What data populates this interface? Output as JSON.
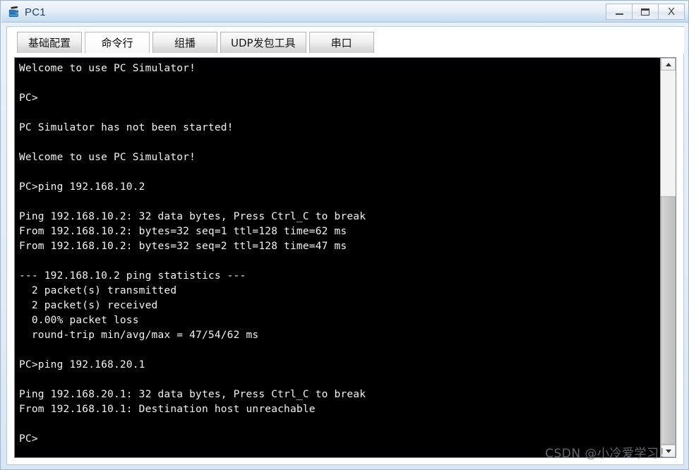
{
  "window": {
    "title": "PC1",
    "icon": "pc-device-icon",
    "controls": {
      "minimize_label": "—",
      "maximize_label": "□",
      "close_label": "X"
    }
  },
  "tabs": [
    {
      "id": "basic-config",
      "label": "基础配置",
      "active": false
    },
    {
      "id": "command-line",
      "label": "命令行",
      "active": true
    },
    {
      "id": "multicast",
      "label": "组播",
      "active": false
    },
    {
      "id": "udp-tool",
      "label": "UDP发包工具",
      "active": false
    },
    {
      "id": "serial-port",
      "label": "串口",
      "active": false
    }
  ],
  "terminal": {
    "foreground_color": "#f2f2f2",
    "background_color": "#000000",
    "lines": [
      "Welcome to use PC Simulator!",
      "",
      "PC>",
      "",
      "PC Simulator has not been started!",
      "",
      "Welcome to use PC Simulator!",
      "",
      "PC>ping 192.168.10.2",
      "",
      "Ping 192.168.10.2: 32 data bytes, Press Ctrl_C to break",
      "From 192.168.10.2: bytes=32 seq=1 ttl=128 time=62 ms",
      "From 192.168.10.2: bytes=32 seq=2 ttl=128 time=47 ms",
      "",
      "--- 192.168.10.2 ping statistics ---",
      "  2 packet(s) transmitted",
      "  2 packet(s) received",
      "  0.00% packet loss",
      "  round-trip min/avg/max = 47/54/62 ms",
      "",
      "PC>ping 192.168.20.1",
      "",
      "Ping 192.168.20.1: 32 data bytes, Press Ctrl_C to break",
      "From 192.168.10.1: Destination host unreachable",
      "",
      "PC>"
    ]
  },
  "scrollbar": {
    "up_arrow": "chevron-up",
    "down_arrow": "chevron-down"
  },
  "watermark": {
    "text": "CSDN @小冷爱学习！"
  }
}
